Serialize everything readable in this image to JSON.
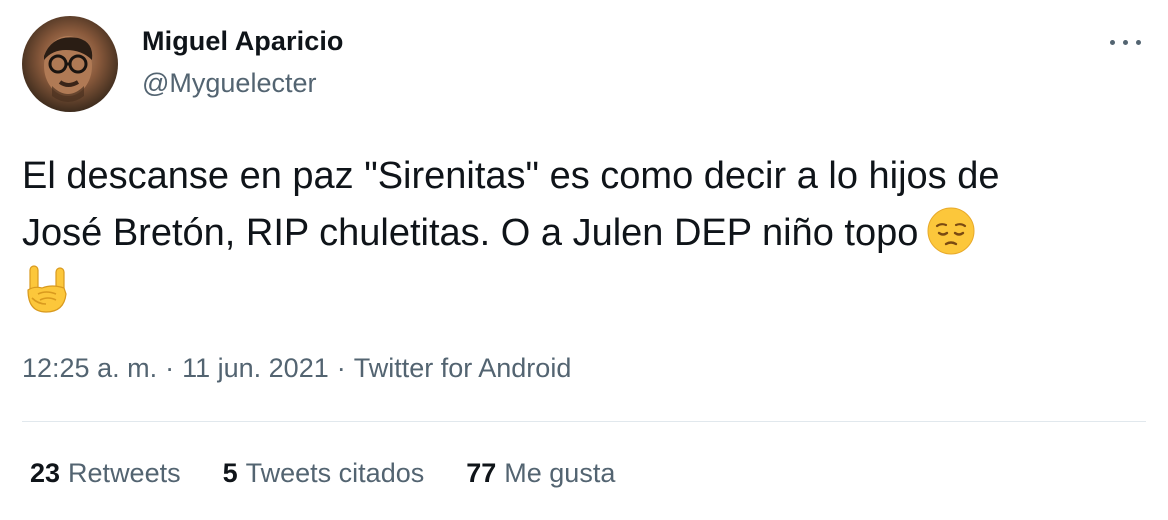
{
  "author": {
    "name": "Miguel Aparicio",
    "handle": "@Myguelecter"
  },
  "tweet": {
    "line1": "El descanse en paz \"Sirenitas\" es como decir a lo hijos de",
    "line2": "José Bretón, RIP chuletitas. O a Julen DEP niño topo",
    "emojis": [
      "pensive-face-emoji",
      "sign-of-the-horns-emoji"
    ]
  },
  "meta": {
    "time": "12:25 a. m.",
    "separator1": "·",
    "date": "11 jun. 2021",
    "separator2": "·",
    "source": "Twitter for Android"
  },
  "stats": {
    "retweets_count": "23",
    "retweets_label": "Retweets",
    "quotes_count": "5",
    "quotes_label": "Tweets citados",
    "likes_count": "77",
    "likes_label": "Me gusta"
  },
  "colors": {
    "primary_text": "#0f1419",
    "secondary_text": "#536471",
    "divider": "#e1e8ed",
    "emoji_yellow": "#fcc73b"
  }
}
